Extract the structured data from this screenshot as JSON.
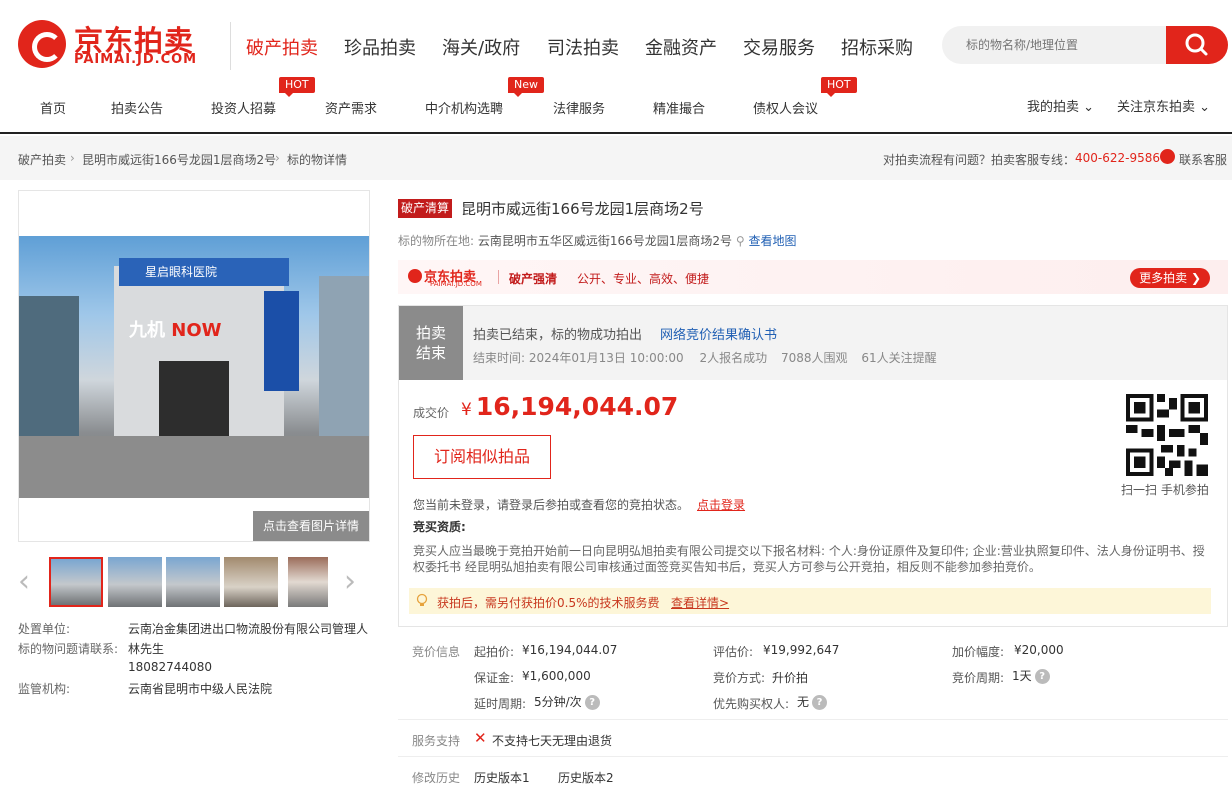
{
  "brand": {
    "name_cn": "京东拍卖",
    "name_en": "PAIMAI.JD.COM",
    "color": "#e1251b"
  },
  "top_nav": [
    "破产拍卖",
    "珍品拍卖",
    "海关/政府",
    "司法拍卖",
    "金融资产",
    "交易服务",
    "招标采购"
  ],
  "search": {
    "placeholder": "标的物名称/地理位置"
  },
  "sub_nav": [
    "首页",
    "拍卖公告",
    "投资人招募",
    "资产需求",
    "中介机构选聘",
    "法律服务",
    "精准撮合",
    "债权人会议"
  ],
  "tags": {
    "hot1": "HOT",
    "new": "New",
    "hot2": "HOT"
  },
  "user": {
    "my_auction": "我的拍卖",
    "follow": "关注京东拍卖"
  },
  "breadcrumb": [
    "破产拍卖",
    "昆明市威远街166号龙园1层商场2号",
    "标的物详情"
  ],
  "help_bar": {
    "question": "对拍卖流程有问题？拍卖客服专线：",
    "phone": "400-622-9586",
    "service": "联系客服"
  },
  "gallery": {
    "view_detail": "点击查看图片详情",
    "sign_text": "星启眼科医院",
    "now_prefix": "九机",
    "now_word": "NOW"
  },
  "left_info": {
    "unit_label": "处置单位:",
    "unit_value": "云南冶金集团进出口物流股份有限公司管理人",
    "contact_label": "标的物问题请联系:",
    "contact_name": "林先生",
    "contact_phone": "18082744080",
    "court_label": "监管机构:",
    "court_value": "云南省昆明市中级人民法院"
  },
  "item": {
    "badge": "破产清算",
    "title": "昆明市威远街166号龙园1层商场2号",
    "location_label": "标的物所在地:",
    "location": "云南昆明市五华区威远街166号龙园1层商场2号",
    "map_link": "查看地图"
  },
  "banner": {
    "logo": "京东拍卖",
    "logo_sub": "PAIMAI.JD.COM",
    "tag": "破产强清",
    "slogan": "公开、专业、高效、便捷",
    "more": "更多拍卖 ❯"
  },
  "status": {
    "badge_line1": "拍卖",
    "badge_line2": "结束",
    "text": "拍卖已结束，标的物成功拍出",
    "result_link": "网络竞价结果确认书",
    "end_time": "结束时间:   2024年01月13日  10:00:00",
    "signup": "2人报名成功",
    "watchers": "7088人围观",
    "reminders": "61人关注提醒"
  },
  "deal": {
    "label": "成交价",
    "currency": "¥",
    "price": "16,194,044.07",
    "subscribe": "订阅相似拍品"
  },
  "qr": {
    "caption": "扫一扫 手机参拍"
  },
  "login": {
    "text": "您当前未登录，请登录后参拍或查看您的竞拍状态。",
    "link": "点击登录"
  },
  "qualification": {
    "title": "竞买资质:",
    "text": "竞买人应当最晚于竞拍开始前一日向昆明弘旭拍卖有限公司提交以下报名材料: 个人:身份证原件及复印件; 企业:营业执照复印件、法人身份证明书、授权委托书 经昆明弘旭拍卖有限公司审核通过面签竞买告知书后，竞买人方可参与公开竞拍，相反则不能参加参拍竞价。"
  },
  "fee": {
    "text": "获拍后，需另付获拍价0.5%的技术服务费",
    "link": "查看详情>"
  },
  "bid_info": {
    "section_label": "竞价信息",
    "start_price_label": "起拍价:",
    "start_price": "¥16,194,044.07",
    "eval_price_label": "评估价:",
    "eval_price": "¥19,992,647",
    "increment_label": "加价幅度:",
    "increment": "¥20,000",
    "deposit_label": "保证金:",
    "deposit": "¥1,600,000",
    "method_label": "竞价方式:",
    "method": "升价拍",
    "period_label": "竞价周期:",
    "period": "1天",
    "delay_label": "延时周期:",
    "delay": "5分钟/次",
    "priority_label": "优先购买权人:",
    "priority": "无"
  },
  "service": {
    "label": "服务支持",
    "text": "不支持七天无理由退货"
  },
  "history": {
    "label": "修改历史",
    "items": [
      "历史版本1",
      "历史版本2"
    ]
  }
}
